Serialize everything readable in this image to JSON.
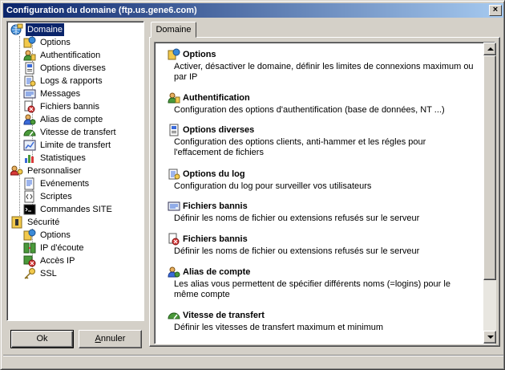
{
  "window": {
    "title": "Configuration du domaine (ftp.us.gene6.com)",
    "close_glyph": "×"
  },
  "tree": {
    "items": [
      {
        "label": "Domaine",
        "icon": "domain-globe-icon",
        "level": 0,
        "selected": true
      },
      {
        "label": "Options",
        "icon": "options-icon",
        "level": 1
      },
      {
        "label": "Authentification",
        "icon": "authentication-icon",
        "level": 1
      },
      {
        "label": "Options diverses",
        "icon": "misc-options-icon",
        "level": 1
      },
      {
        "label": "Logs & rapports",
        "icon": "logs-icon",
        "level": 1
      },
      {
        "label": "Messages",
        "icon": "messages-icon",
        "level": 1
      },
      {
        "label": "Fichiers bannis",
        "icon": "banned-files-icon",
        "level": 1
      },
      {
        "label": "Alias de compte",
        "icon": "account-alias-icon",
        "level": 1
      },
      {
        "label": "Vitesse de transfert",
        "icon": "transfer-speed-icon",
        "level": 1
      },
      {
        "label": "Limite de transfert",
        "icon": "transfer-limit-icon",
        "level": 1
      },
      {
        "label": "Statistiques",
        "icon": "statistics-icon",
        "level": 1
      },
      {
        "label": "Personnaliser",
        "icon": "customize-icon",
        "level": 0
      },
      {
        "label": "Evénements",
        "icon": "events-icon",
        "level": 1
      },
      {
        "label": "Scriptes",
        "icon": "scripts-icon",
        "level": 1
      },
      {
        "label": "Commandes SITE",
        "icon": "site-commands-icon",
        "level": 1
      },
      {
        "label": "Sécurité",
        "icon": "security-icon",
        "level": 0
      },
      {
        "label": "Options",
        "icon": "security-options-icon",
        "level": 1
      },
      {
        "label": "IP d'écoute",
        "icon": "listen-ip-icon",
        "level": 1
      },
      {
        "label": "Accès IP",
        "icon": "ip-access-icon",
        "level": 1
      },
      {
        "label": "SSL",
        "icon": "ssl-key-icon",
        "level": 1
      }
    ]
  },
  "buttons": {
    "ok": "Ok",
    "cancel_underlined": "A",
    "cancel_rest": "nnuler"
  },
  "tab": {
    "label": "Domaine"
  },
  "content": {
    "items": [
      {
        "title": "Options",
        "icon": "options-icon",
        "desc": "Activer, désactiver le domaine, définir les limites de connexions maximum ou par IP"
      },
      {
        "title": "Authentification",
        "icon": "authentication-icon",
        "desc": "Configuration des options d'authentification (base de données, NT ...)"
      },
      {
        "title": "Options diverses",
        "icon": "misc-options-icon",
        "desc": "Configuration des options clients, anti-hammer et les régles pour l'effacement de fichiers"
      },
      {
        "title": "Options du log",
        "icon": "logs-icon",
        "desc": "Configuration du log pour surveiller vos utilisateurs"
      },
      {
        "title": "Fichiers bannis",
        "icon": "messages-icon",
        "desc": "Définir les noms de fichier ou extensions refusés sur le serveur"
      },
      {
        "title": "Fichiers bannis",
        "icon": "banned-files-icon",
        "desc": "Définir les noms de fichier ou extensions refusés sur le serveur"
      },
      {
        "title": "Alias de compte",
        "icon": "account-alias-icon",
        "desc": "Les alias vous permettent de spécifier différents noms (=logins) pour le même compte"
      },
      {
        "title": "Vitesse de transfert",
        "icon": "transfer-speed-icon",
        "desc": "Définir les vitesses de transfert maximum et minimum"
      }
    ]
  }
}
